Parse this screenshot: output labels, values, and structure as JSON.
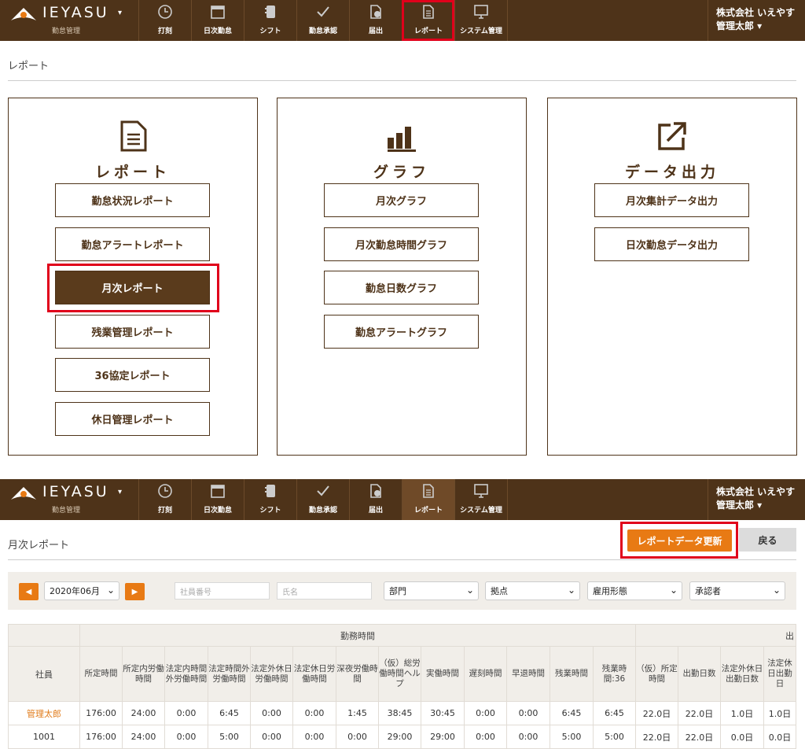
{
  "header": {
    "brand": "IEYASU",
    "caret": "▾",
    "subtitle": "勤怠管理",
    "nav": [
      {
        "label": "打刻",
        "icon": "clock-icon"
      },
      {
        "label": "日次勤怠",
        "icon": "calendar-icon"
      },
      {
        "label": "シフト",
        "icon": "notebook-icon"
      },
      {
        "label": "勤怠承認",
        "icon": "check-icon"
      },
      {
        "label": "届出",
        "icon": "upload-doc-icon"
      },
      {
        "label": "レポート",
        "icon": "document-icon"
      },
      {
        "label": "システム管理",
        "icon": "monitor-icon"
      }
    ],
    "company": "株式会社 いえやす",
    "user": "管理太郎 ▾"
  },
  "reports_page": {
    "title": "レポート",
    "cards": [
      {
        "title": "レポート",
        "icon": "document-icon",
        "buttons": [
          "勤怠状況レポート",
          "勤怠アラートレポート",
          "月次レポート",
          "残業管理レポート",
          "36協定レポート",
          "休日管理レポート"
        ]
      },
      {
        "title": "グラフ",
        "icon": "bar-chart-icon",
        "buttons": [
          "月次グラフ",
          "月次勤怠時間グラフ",
          "勤怠日数グラフ",
          "勤怠アラートグラフ"
        ]
      },
      {
        "title": "データ出力",
        "icon": "export-icon",
        "buttons": [
          "月次集計データ出力",
          "日次勤怠データ出力"
        ]
      }
    ]
  },
  "monthly_page": {
    "title": "月次レポート",
    "update_button": "レポートデータ更新",
    "back_button": "戻る",
    "filters": {
      "prev": "◀",
      "next": "▶",
      "month": "2020年06月",
      "employee_no_placeholder": "社員番号",
      "name_placeholder": "氏名",
      "dept": "部門",
      "site": "拠点",
      "employment": "雇用形態",
      "approver": "承認者"
    },
    "table": {
      "group_header": "勤務時間",
      "group_header2": "出",
      "col_employee": "社員",
      "columns": [
        "所定時間",
        "所定内労働時間",
        "法定内時間外労働時間",
        "法定時間外労働時間",
        "法定外休日労働時間",
        "法定休日労働時間",
        "深夜労働時間",
        "（仮）総労働時間ヘルプ",
        "実働時間",
        "遅刻時間",
        "早退時間",
        "残業時間",
        "残業時間:36",
        "（仮）所定時間",
        "出勤日数",
        "法定外休日出勤日数",
        "法定休日出勤日"
      ],
      "rows": [
        {
          "employee": "管理太郎",
          "values": [
            "176:00",
            "24:00",
            "0:00",
            "6:45",
            "0:00",
            "0:00",
            "1:45",
            "38:45",
            "30:45",
            "0:00",
            "0:00",
            "6:45",
            "6:45",
            "22.0日",
            "22.0日",
            "1.0日",
            "1.0日"
          ]
        },
        {
          "employee": "1001",
          "values": [
            "176:00",
            "24:00",
            "0:00",
            "5:00",
            "0:00",
            "0:00",
            "0:00",
            "29:00",
            "29:00",
            "0:00",
            "0:00",
            "5:00",
            "5:00",
            "22.0日",
            "22.0日",
            "0.0日",
            "0.0日"
          ]
        }
      ]
    }
  }
}
